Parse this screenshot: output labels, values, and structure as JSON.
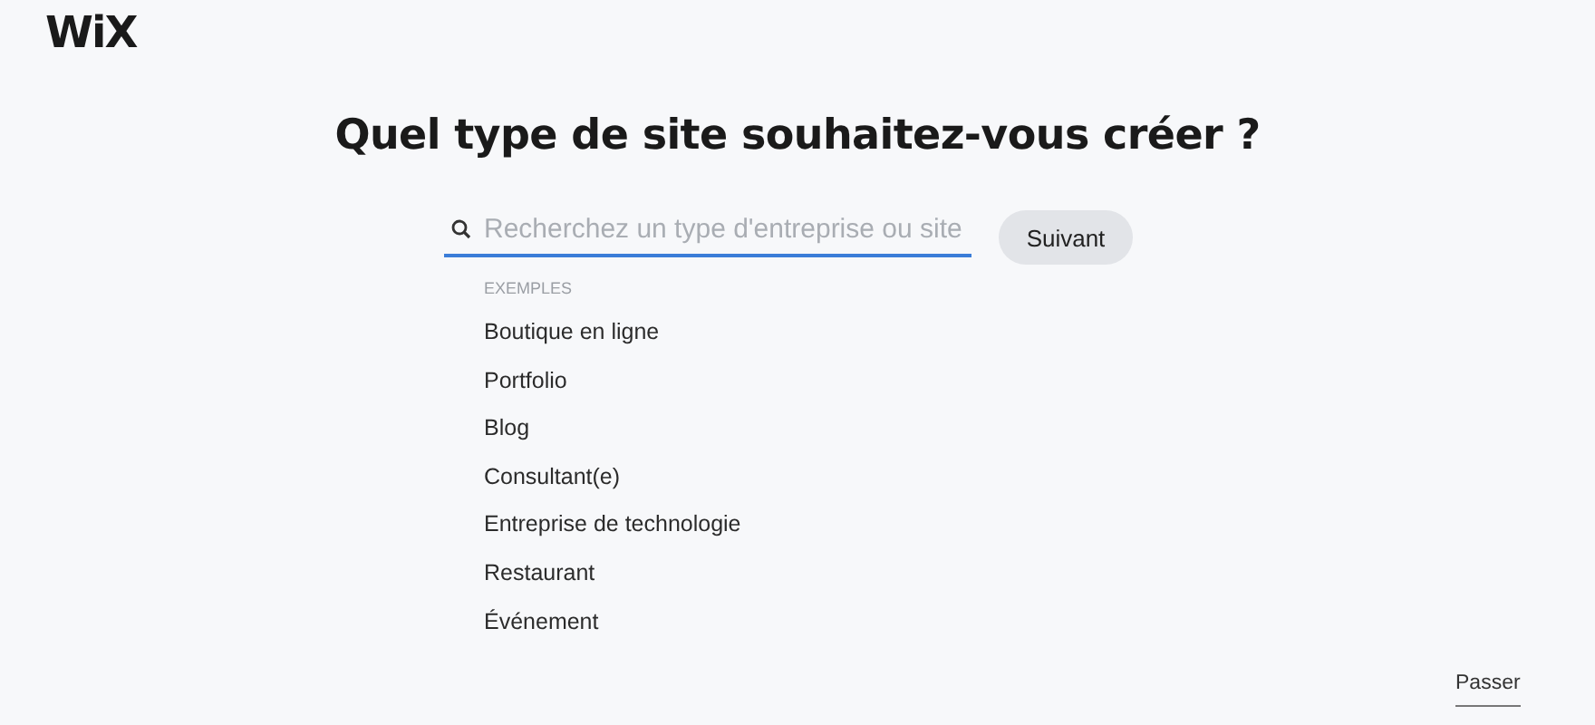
{
  "logo": "WiX",
  "title": "Quel type de site souhaitez-vous créer ?",
  "search": {
    "placeholder": "Recherchez un type d'entreprise ou site"
  },
  "next_button": "Suivant",
  "examples_heading": "EXEMPLES",
  "examples": [
    "Boutique en ligne",
    "Portfolio",
    "Blog",
    "Consultant(e)",
    "Entreprise de technologie",
    "Restaurant",
    "Événement"
  ],
  "skip_link": "Passer"
}
